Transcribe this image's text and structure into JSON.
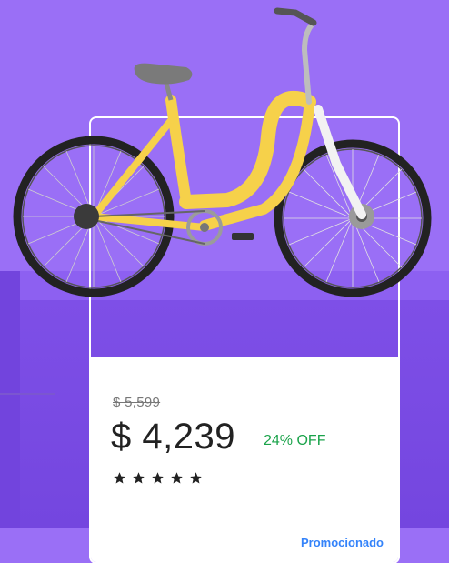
{
  "product": {
    "old_price": "$ 5,599",
    "price": "$ 4,239",
    "discount": "24% OFF",
    "rating_stars": 5,
    "promo_label": "Promocionado"
  },
  "colors": {
    "background": "#9a6ff6",
    "pedestal": "#7e4fe7",
    "price_text": "#222222",
    "discount_text": "#1aa34a",
    "promo_text": "#3483fa",
    "bike_frame": "#f6d14a"
  },
  "icons": {
    "rating": "star-icon",
    "product_image": "bicycle-icon"
  }
}
